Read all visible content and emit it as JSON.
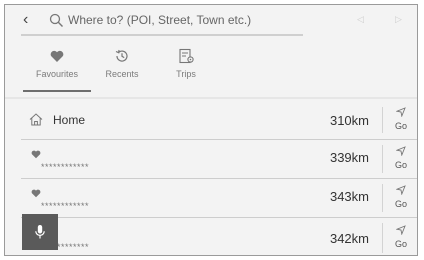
{
  "search": {
    "placeholder": "Where to? (POI, Street, Town etc.)"
  },
  "tabs": [
    {
      "label": "Favourites",
      "icon": "heart-icon",
      "selected": true
    },
    {
      "label": "Recents",
      "icon": "history-icon",
      "selected": false
    },
    {
      "label": "Trips",
      "icon": "trip-list-icon",
      "selected": false
    }
  ],
  "rows": [
    {
      "name": "Home",
      "icon": "home-icon",
      "distance": "310km",
      "go_label": "Go"
    },
    {
      "name": "************",
      "icon": "heart-icon",
      "distance": "339km",
      "go_label": "Go"
    },
    {
      "name": "************",
      "icon": "heart-icon",
      "distance": "343km",
      "go_label": "Go"
    },
    {
      "name": "************",
      "icon": "heart-icon",
      "distance": "342km",
      "go_label": "Go"
    }
  ],
  "voice_button": {
    "icon": "microphone-icon"
  }
}
